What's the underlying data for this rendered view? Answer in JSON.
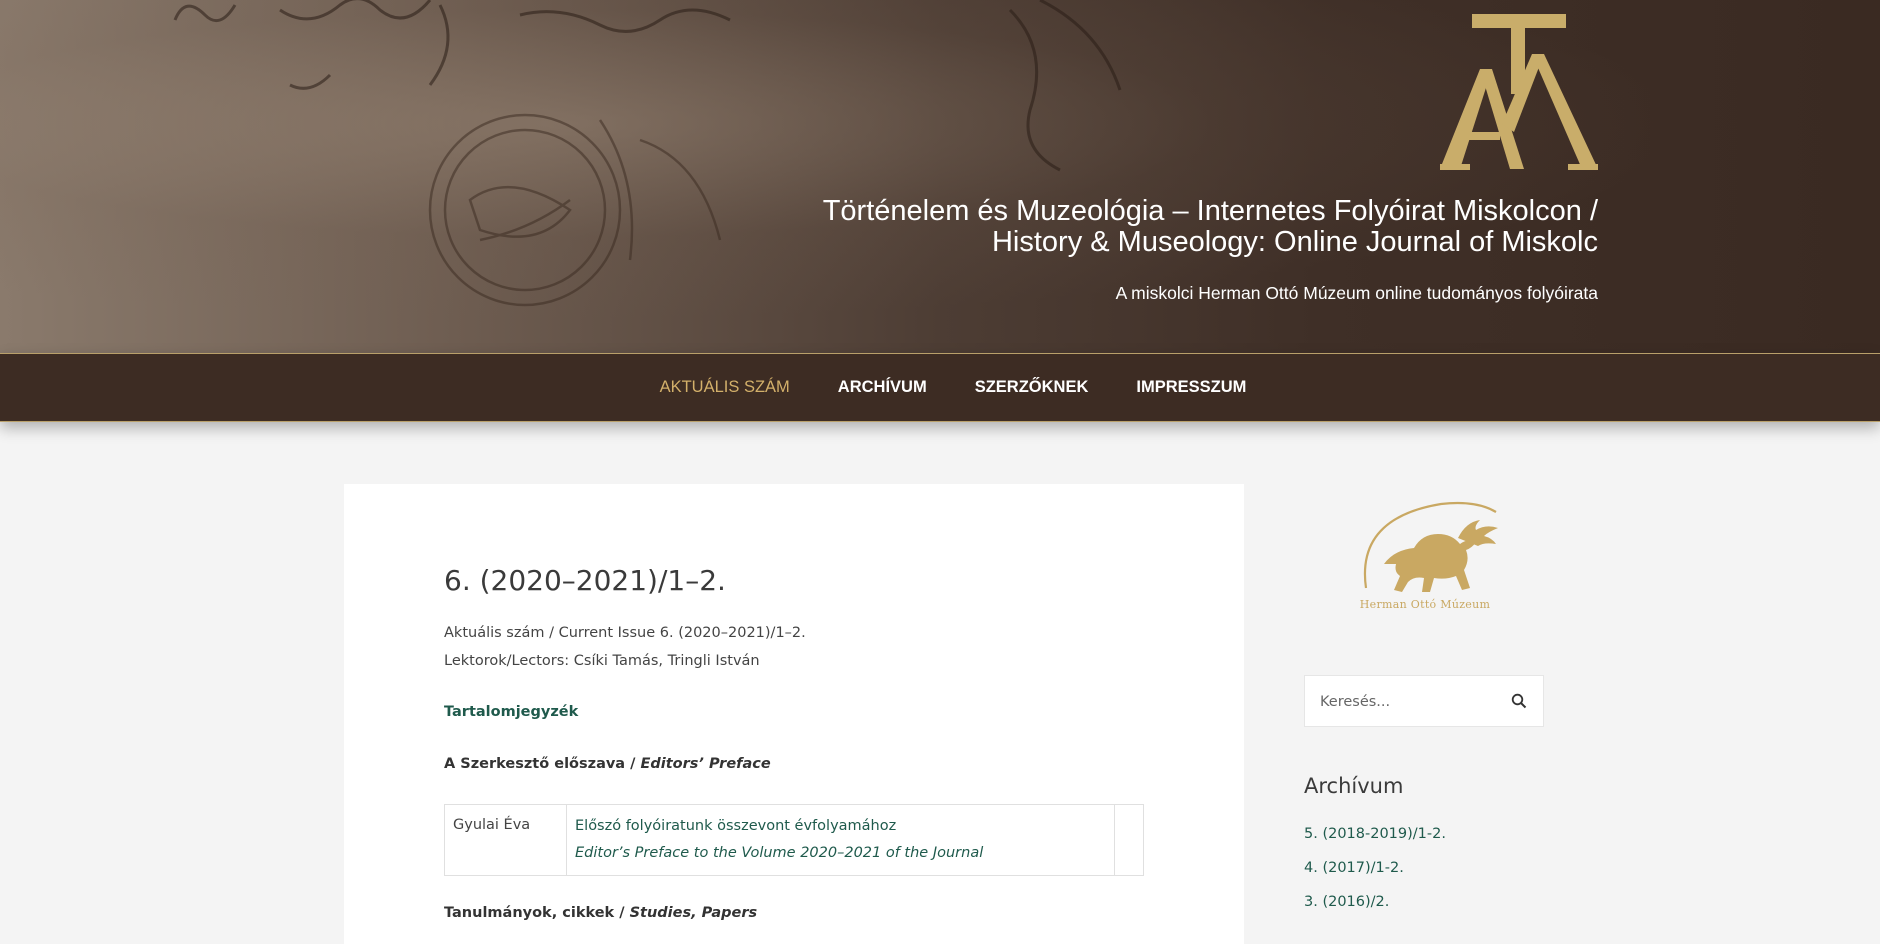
{
  "header": {
    "site_title_line1": "Történelem és Muzeológia – Internetes Folyóirat Miskolcon /",
    "site_title_line2": "History & Museology: Online Journal of Miskolc",
    "tagline": "A miskolci Herman Ottó Múzeum online tudományos folyóirata",
    "logo_icon": "tm-monogram-logo",
    "accent_color": "#c9ad6a"
  },
  "nav": {
    "items": [
      {
        "label": "AKTUÁLIS SZÁM",
        "active": true
      },
      {
        "label": "ARCHÍVUM",
        "active": false
      },
      {
        "label": "SZERZŐKNEK",
        "active": false
      },
      {
        "label": "IMPRESSZUM",
        "active": false
      }
    ],
    "active_color": "#d3b06a",
    "background": "#3d2c23"
  },
  "article": {
    "title": "6. (2020–2021)/1–2.",
    "meta_current_issue": "Aktuális szám / Current Issue 6. (2020–2021)/1–2.",
    "meta_lectors": "Lektorok/Lectors: Csíki Tamás, Tringli István",
    "toc_heading": "Tartalomjegyzék",
    "sections": [
      {
        "label": "A Szerkesztő előszava / ",
        "label_en": "Editors’ Preface"
      },
      {
        "label": "Tanulmányok, cikkek / ",
        "label_en": "Studies, Papers"
      }
    ],
    "entries": [
      {
        "author": "Gyulai Éva",
        "title_hu": "Előszó folyóiratunk összevont évfolyamához",
        "title_en": "Editor’s Preface to the Volume 2020–2021 of the Journal"
      }
    ],
    "link_color": "#1f5a4c"
  },
  "sidebar": {
    "museum_logo_icon": "herman-otto-museum-logo",
    "museum_name": "Herman Ottó Múzeum",
    "search": {
      "placeholder": "Keresés...",
      "icon": "search-icon"
    },
    "archive_title": "Archívum",
    "archive_items": [
      "5. (2018-2019)/1-2.",
      "4. (2017)/1-2.",
      "3. (2016)/2."
    ]
  }
}
